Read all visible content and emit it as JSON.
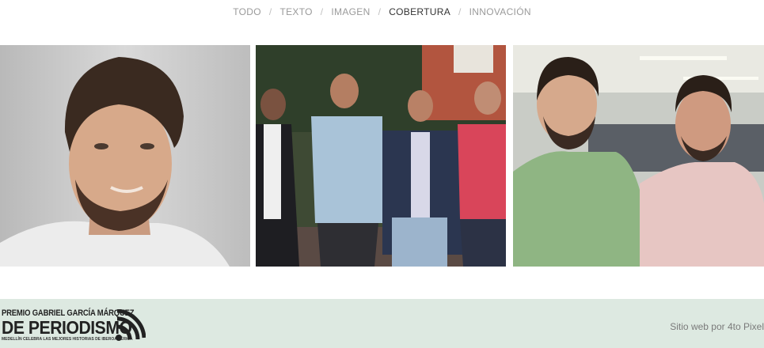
{
  "filters": {
    "items": [
      "TODO",
      "TEXTO",
      "IMAGEN",
      "COBERTURA",
      "INNOVACIÓN"
    ],
    "separator": "/",
    "active": "COBERTURA"
  },
  "photos": [
    {
      "alt": "Retrato de hombre con barba sobre fondo gris"
    },
    {
      "alt": "Cuatro hombres de pie al aire libre"
    },
    {
      "alt": "Dos hombres con brazos cruzados en oficina"
    }
  ],
  "footer": {
    "logo_line1": "PREMIO GABRIEL GARCÍA MÁRQUEZ",
    "logo_line2": "DE PERIODISMO",
    "logo_line3": "MEDELLÍN CELEBRA LAS MEJORES HISTORIAS DE IBEROAMÉRICA",
    "credit": "Sitio web por 4to Pixel"
  },
  "colors": {
    "footer_bg": "#dde9e1",
    "filter_text": "#9a9a9a",
    "filter_active": "#333333"
  }
}
